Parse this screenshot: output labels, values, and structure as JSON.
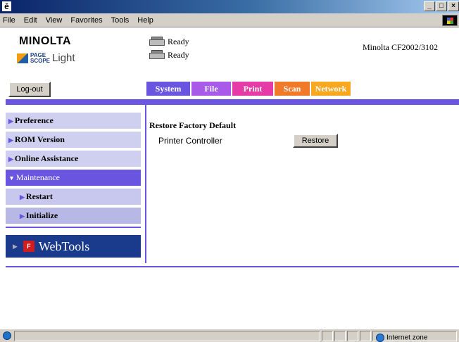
{
  "window": {
    "buttons": [
      "_",
      "□",
      "×"
    ]
  },
  "menubar": {
    "items": [
      "File",
      "Edit",
      "View",
      "Favorites",
      "Tools",
      "Help"
    ]
  },
  "header": {
    "logo": "MINOLTA",
    "logo_sub_page": "PAGE",
    "logo_sub_scope": "SCOPE",
    "logo_sub_light": "Light",
    "status": [
      {
        "icon": "scanner-icon",
        "text": "Ready"
      },
      {
        "icon": "printer-icon",
        "text": "Ready"
      }
    ],
    "model": "Minolta CF2002/3102"
  },
  "logout_label": "Log-out",
  "tabs": [
    {
      "label": "System",
      "color": "#6a55e0"
    },
    {
      "label": "File",
      "color": "#a85ae8"
    },
    {
      "label": "Print",
      "color": "#e63aa6"
    },
    {
      "label": "Scan",
      "color": "#f07a2a"
    },
    {
      "label": "Network",
      "color": "#f7a81e"
    }
  ],
  "sidebar": {
    "items": [
      {
        "label": "Preference"
      },
      {
        "label": "ROM Version"
      },
      {
        "label": "Online Assistance"
      },
      {
        "label": "Maintenance"
      },
      {
        "label": "Restart"
      },
      {
        "label": "Initialize"
      }
    ],
    "webtools_label": "WebTools"
  },
  "main": {
    "section_title": "Restore Factory Default",
    "row_label": "Printer Controller",
    "restore_label": "Restore"
  },
  "statusbar": {
    "zone": "Internet zone"
  },
  "colors": {
    "accent": "#6a55e0",
    "sidebar_bg": "#cfd0f0",
    "webtools_bg": "#1a3a8c"
  }
}
